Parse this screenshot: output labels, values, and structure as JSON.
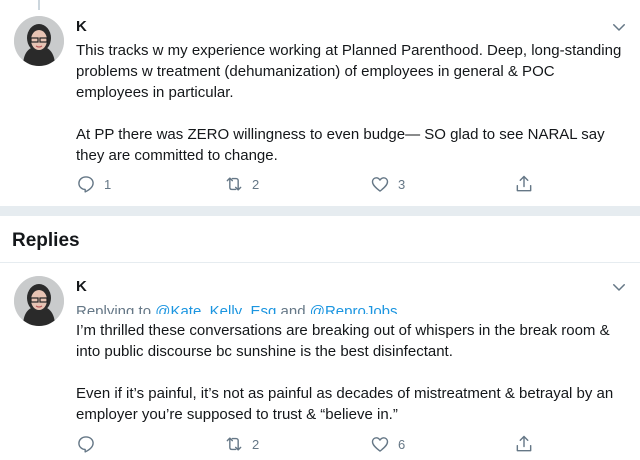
{
  "tweet": {
    "author": "K",
    "body": "This tracks w my experience working at Planned Parenthood. Deep, long-standing problems w treatment (dehumanization) of employees in general & POC employees in particular.\n\nAt PP there was ZERO willingness to even budge— SO glad to see NARAL say they are committed to change.",
    "reply_count": "1",
    "retweet_count": "2",
    "like_count": "3"
  },
  "replies_heading": "Replies",
  "reply": {
    "author": "K",
    "replying_prefix": "Replying to ",
    "replying_user1": "@Kate_Kelly_Esq",
    "replying_and": " and ",
    "replying_user2": "@ReproJobs",
    "body": "I’m thrilled these conversations are breaking out of whispers in the break room & into public discourse bc sunshine is the best disinfectant.\n\nEven if it’s painful, it’s not as painful as decades of mistreatment & betrayal by an employer you’re supposed to trust & “believe in.”",
    "reply_count": "",
    "retweet_count": "2",
    "like_count": "6"
  },
  "colors": {
    "text": "#14171a",
    "muted": "#657786",
    "link": "#1b95e0",
    "divider": "#e6ecf0"
  },
  "icons": [
    "chevron-down-icon",
    "reply-icon",
    "retweet-icon",
    "like-icon",
    "share-icon"
  ]
}
